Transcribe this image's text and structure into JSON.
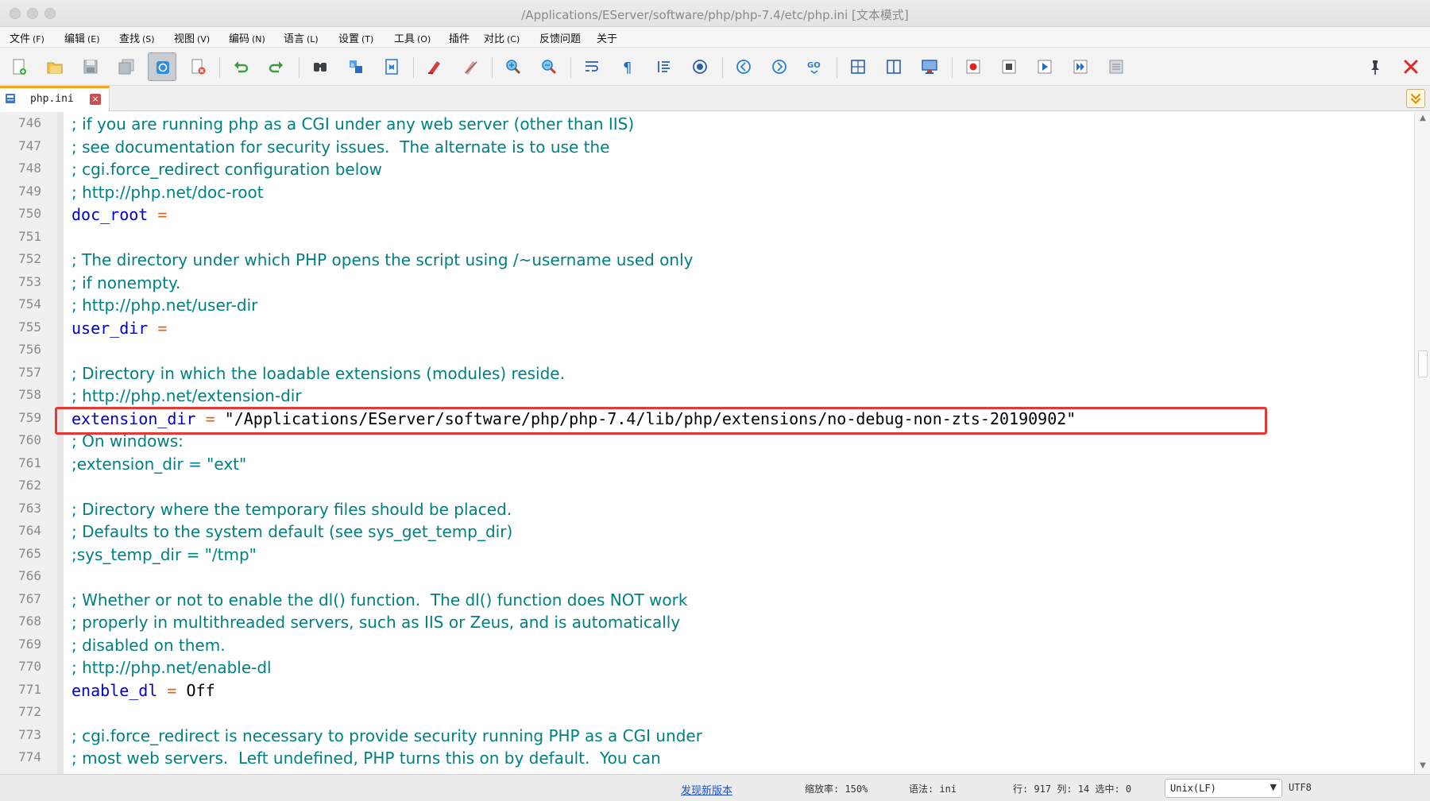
{
  "window": {
    "title": "/Applications/EServer/software/php/php-7.4/etc/php.ini [文本模式]"
  },
  "menu": [
    {
      "label": "文件",
      "key": "(F)"
    },
    {
      "label": "编辑",
      "key": "(E)"
    },
    {
      "label": "查找",
      "key": "(S)"
    },
    {
      "label": "视图",
      "key": "(V)"
    },
    {
      "label": "编码",
      "key": "(N)"
    },
    {
      "label": "语言",
      "key": "(L)"
    },
    {
      "label": "设置",
      "key": "(T)"
    },
    {
      "label": "工具",
      "key": "(O)"
    },
    {
      "label": "插件",
      "key": ""
    },
    {
      "label": "对比",
      "key": "(C)"
    },
    {
      "label": "反馈问题",
      "key": ""
    },
    {
      "label": "关于",
      "key": ""
    }
  ],
  "toolbar": {
    "icons": [
      "new-file-icon",
      "open-file-icon",
      "save-icon",
      "save-all-icon",
      "auto-save-icon",
      "close-file-icon",
      "undo-icon",
      "redo-icon",
      "find-icon",
      "replace-icon",
      "bookmark-icon",
      "mark-icon",
      "clear-mark-icon",
      "zoom-in-icon",
      "zoom-out-icon",
      "word-wrap-icon",
      "show-symbols-icon",
      "indent-guide-icon",
      "focus-icon",
      "back-icon",
      "forward-icon",
      "goto-icon",
      "split-view-icon",
      "compare-icon",
      "monitor-icon",
      "record-macro-icon",
      "stop-macro-icon",
      "play-macro-icon",
      "run-macro-multiple-icon",
      "save-macro-icon",
      "pin-icon",
      "close-icon"
    ],
    "active_icon": "auto-save-icon"
  },
  "tab": {
    "label": "php.ini",
    "close_glyph": "×",
    "accent_color": "#f5a623"
  },
  "editor": {
    "colors": {
      "comment": "#008080",
      "key": "#0000c8",
      "operator": "#d2691e",
      "value": "#000000",
      "highlight_border": "#e53935"
    },
    "highlighted_line": 759,
    "lines": [
      {
        "num": "746",
        "type": "comment",
        "text": "; if you are running php as a CGI under any web server (other than IIS)"
      },
      {
        "num": "747",
        "type": "comment",
        "text": "; see documentation for security issues.  The alternate is to use the"
      },
      {
        "num": "748",
        "type": "comment",
        "text": "; cgi.force_redirect configuration below"
      },
      {
        "num": "749",
        "type": "comment",
        "text": "; http://php.net/doc-root"
      },
      {
        "num": "750",
        "type": "setting",
        "key": "doc_root",
        "op": " =",
        "value": ""
      },
      {
        "num": "751",
        "type": "blank",
        "text": ""
      },
      {
        "num": "752",
        "type": "comment",
        "text": "; The directory under which PHP opens the script using /~username used only"
      },
      {
        "num": "753",
        "type": "comment",
        "text": "; if nonempty."
      },
      {
        "num": "754",
        "type": "comment",
        "text": "; http://php.net/user-dir"
      },
      {
        "num": "755",
        "type": "setting",
        "key": "user_dir",
        "op": " =",
        "value": ""
      },
      {
        "num": "756",
        "type": "blank",
        "text": ""
      },
      {
        "num": "757",
        "type": "comment",
        "text": "; Directory in which the loadable extensions (modules) reside."
      },
      {
        "num": "758",
        "type": "comment",
        "text": "; http://php.net/extension-dir"
      },
      {
        "num": "759",
        "type": "setting",
        "key": "extension_dir",
        "op": " =",
        "value": " \"/Applications/EServer/software/php/php-7.4/lib/php/extensions/no-debug-non-zts-20190902\""
      },
      {
        "num": "760",
        "type": "comment",
        "text": "; On windows:"
      },
      {
        "num": "761",
        "type": "comment",
        "text": ";extension_dir = \"ext\""
      },
      {
        "num": "762",
        "type": "blank",
        "text": ""
      },
      {
        "num": "763",
        "type": "comment",
        "text": "; Directory where the temporary files should be placed."
      },
      {
        "num": "764",
        "type": "comment",
        "text": "; Defaults to the system default (see sys_get_temp_dir)"
      },
      {
        "num": "765",
        "type": "comment",
        "text": ";sys_temp_dir = \"/tmp\""
      },
      {
        "num": "766",
        "type": "blank",
        "text": ""
      },
      {
        "num": "767",
        "type": "comment",
        "text": "; Whether or not to enable the dl() function.  The dl() function does NOT work"
      },
      {
        "num": "768",
        "type": "comment",
        "text": "; properly in multithreaded servers, such as IIS or Zeus, and is automatically"
      },
      {
        "num": "769",
        "type": "comment",
        "text": "; disabled on them."
      },
      {
        "num": "770",
        "type": "comment",
        "text": "; http://php.net/enable-dl"
      },
      {
        "num": "771",
        "type": "setting",
        "key": "enable_dl",
        "op": " =",
        "value": " Off"
      },
      {
        "num": "772",
        "type": "blank",
        "text": ""
      },
      {
        "num": "773",
        "type": "comment",
        "text": "; cgi.force_redirect is necessary to provide security running PHP as a CGI under"
      },
      {
        "num": "774",
        "type": "comment",
        "text": "; most web servers.  Left undefined, PHP turns this on by default.  You can"
      }
    ]
  },
  "status": {
    "update_link": "发现新版本",
    "zoom": "缩放率: 150%",
    "syntax": "语法: ini",
    "position": "行: 917 列: 14 选中: 0",
    "eol": "Unix(LF)",
    "encoding": "UTF8"
  }
}
